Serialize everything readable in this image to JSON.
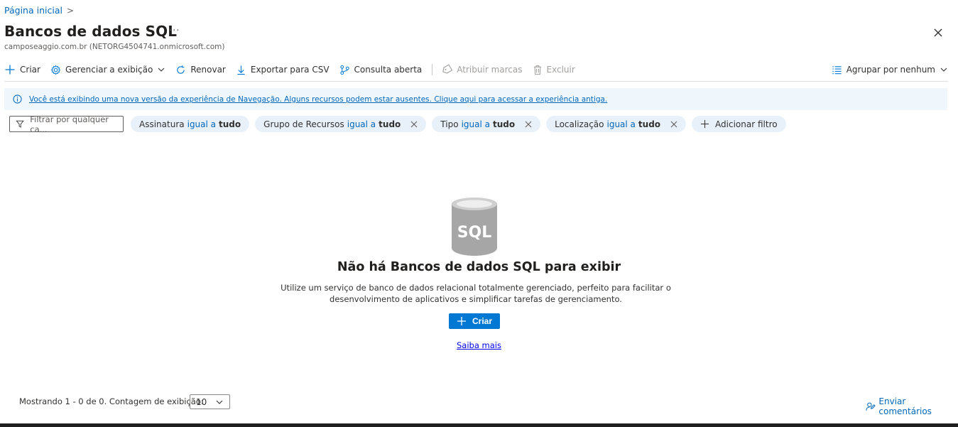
{
  "breadcrumb": {
    "home": "Página inicial",
    "separator": ">"
  },
  "header": {
    "title": "Bancos de dados SQL",
    "more": "···",
    "subtitle": "camposeaggio.com.br (NETORG4504741.onmicrosoft.com)"
  },
  "toolbar": {
    "create": "Criar",
    "manage_view": "Gerenciar a exibição",
    "refresh": "Renovar",
    "export_csv": "Exportar para CSV",
    "open_query": "Consulta aberta",
    "assign_tags": "Atribuir marcas",
    "delete": "Excluir",
    "group_by": "Agrupar por nenhum"
  },
  "info_banner": {
    "text": "Você está exibindo uma nova versão da experiência de Navegação. Alguns recursos podem estar ausentes. Clique aqui para acessar a experiência antiga."
  },
  "filters": {
    "search_placeholder": "Filtrar por qualquer ca...",
    "pills": [
      {
        "name": "Assinatura",
        "op": "igual a",
        "value": "tudo",
        "removable": false
      },
      {
        "name": "Grupo de Recursos",
        "op": "igual a",
        "value": "tudo",
        "removable": true
      },
      {
        "name": "Tipo",
        "op": "igual a",
        "value": "tudo",
        "removable": true
      },
      {
        "name": "Localização",
        "op": "igual a",
        "value": "tudo",
        "removable": true
      }
    ],
    "add_filter": "Adicionar filtro"
  },
  "empty_state": {
    "icon_label": "SQL",
    "title": "Não há Bancos de dados SQL para exibir",
    "description": "Utilize um serviço de banco de dados relacional totalmente gerenciado, perfeito para facilitar o desenvolvimento de aplicativos e simplificar tarefas de gerenciamento.",
    "create_button": "Criar",
    "learn_more": "Saiba mais"
  },
  "footer": {
    "showing": "Mostrando 1 - 0 de 0. Contagem de exibição:",
    "page_size": "10",
    "feedback": "Enviar comentários"
  },
  "colors": {
    "accent": "#0078d4",
    "banner_bg": "#eff6fc",
    "pill_bg": "#e8f1fa"
  }
}
